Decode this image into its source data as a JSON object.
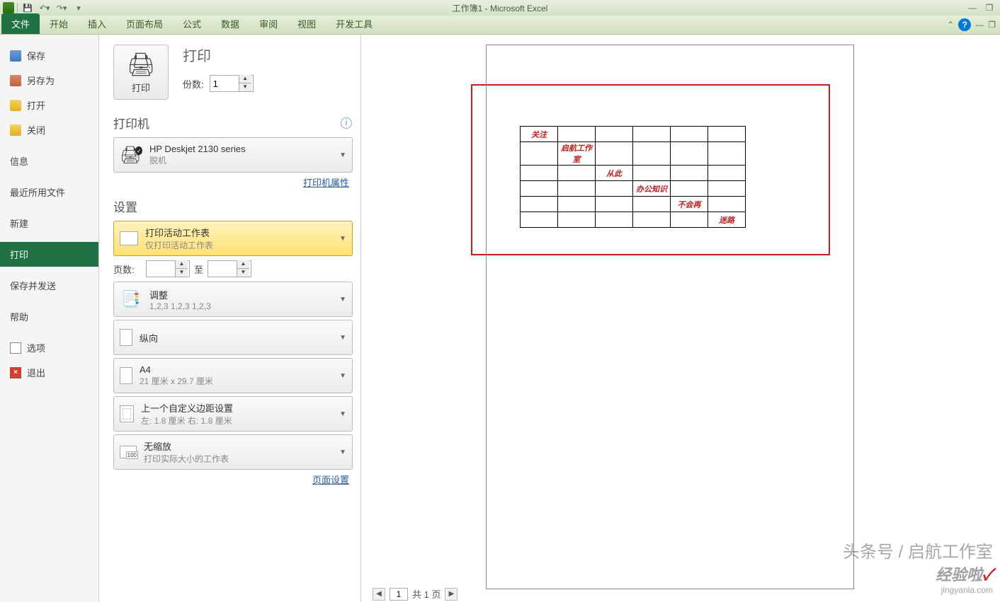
{
  "app": {
    "title": "工作簿1 - Microsoft Excel"
  },
  "ribbon": {
    "tabs": [
      "文件",
      "开始",
      "插入",
      "页面布局",
      "公式",
      "数据",
      "审阅",
      "视图",
      "开发工具"
    ],
    "active_index": 0
  },
  "backstage": {
    "save": "保存",
    "save_as": "另存为",
    "open": "打开",
    "close": "关闭",
    "info": "信息",
    "recent": "最近所用文件",
    "new": "新建",
    "print": "打印",
    "save_send": "保存并发送",
    "help": "帮助",
    "options": "选项",
    "exit": "退出",
    "selected": "print"
  },
  "print": {
    "title": "打印",
    "button_label": "打印",
    "copies_label": "份数:",
    "copies_value": "1",
    "printer_section": "打印机",
    "printer_name": "HP Deskjet 2130 series",
    "printer_status": "脱机",
    "printer_props": "打印机属性",
    "settings_section": "设置",
    "print_what_title": "打印活动工作表",
    "print_what_sub": "仅打印活动工作表",
    "pages_label": "页数:",
    "pages_to": "至",
    "collate_title": "调整",
    "collate_sub": "1,2,3    1,2,3    1,2,3",
    "orientation": "纵向",
    "paper_title": "A4",
    "paper_sub": "21 厘米 x 29.7 厘米",
    "margins_title": "上一个自定义边距设置",
    "margins_sub": "左: 1.8 厘米    右: 1.8 厘米",
    "scale_title": "无缩放",
    "scale_sub": "打印实际大小的工作表",
    "page_setup": "页面设置"
  },
  "preview": {
    "cells": {
      "r0c0": "关注",
      "r1c1": "启航工作室",
      "r2c2": "从此",
      "r3c3": "办公知识",
      "r4c4": "不会再",
      "r5c5": "迷路"
    },
    "nav_current": "1",
    "nav_total": "共 1 页"
  },
  "watermark": {
    "line1": "头条号 / 启航工作室",
    "line2a": "经验啦",
    "line2b": "✓",
    "line3": "jingyanla.com"
  }
}
